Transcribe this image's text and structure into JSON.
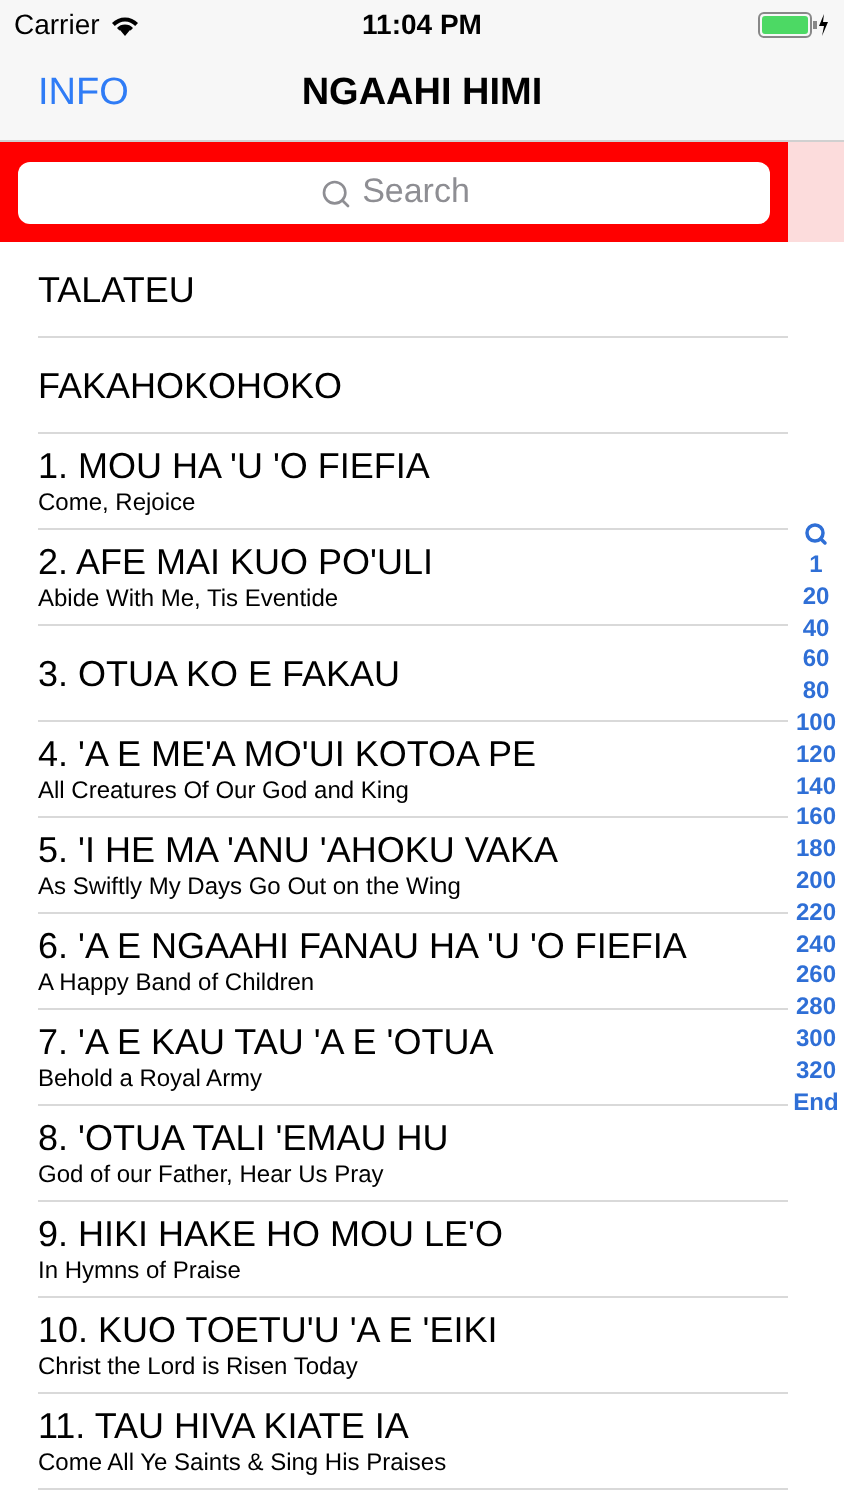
{
  "status_bar": {
    "carrier": "Carrier",
    "time": "11:04 PM"
  },
  "nav": {
    "left_button": "INFO",
    "title": "NGAAHI HIMI"
  },
  "search": {
    "placeholder": "Search"
  },
  "rows": [
    {
      "title": "TALATEU"
    },
    {
      "title": "FAKAHOKOHOKO"
    },
    {
      "title": "1. MOU HA 'U 'O FIEFIA",
      "subtitle": "Come, Rejoice"
    },
    {
      "title": "2. AFE MAI KUO PO'ULI",
      "subtitle": "Abide With Me, Tis Eventide"
    },
    {
      "title": "3. OTUA KO E FAKAU"
    },
    {
      "title": "4. 'A E ME'A MO'UI KOTOA PE",
      "subtitle": "All Creatures Of Our God and King"
    },
    {
      "title": "5. 'I HE MA 'ANU 'AHOKU VAKA",
      "subtitle": "As Swiftly My Days Go Out on the Wing"
    },
    {
      "title": "6. 'A E NGAAHI FANAU HA 'U 'O FIEFIA",
      "subtitle": "A Happy Band of Children"
    },
    {
      "title": "7. 'A E KAU TAU 'A E 'OTUA",
      "subtitle": "Behold a Royal Army"
    },
    {
      "title": "8. 'OTUA TALI 'EMAU HU",
      "subtitle": "God of our Father, Hear Us Pray"
    },
    {
      "title": "9. HIKI HAKE HO MOU LE'O",
      "subtitle": "In Hymns of Praise"
    },
    {
      "title": "10. KUO TOETU'U 'A E 'EIKI",
      "subtitle": "Christ the Lord is Risen Today"
    },
    {
      "title": "11. TAU HIVA KIATE IA",
      "subtitle": "Come All Ye Saints & Sing His Praises"
    }
  ],
  "index": [
    "1",
    "20",
    "40",
    "60",
    "80",
    "100",
    "120",
    "140",
    "160",
    "180",
    "200",
    "220",
    "240",
    "260",
    "280",
    "300",
    "320",
    "End"
  ]
}
